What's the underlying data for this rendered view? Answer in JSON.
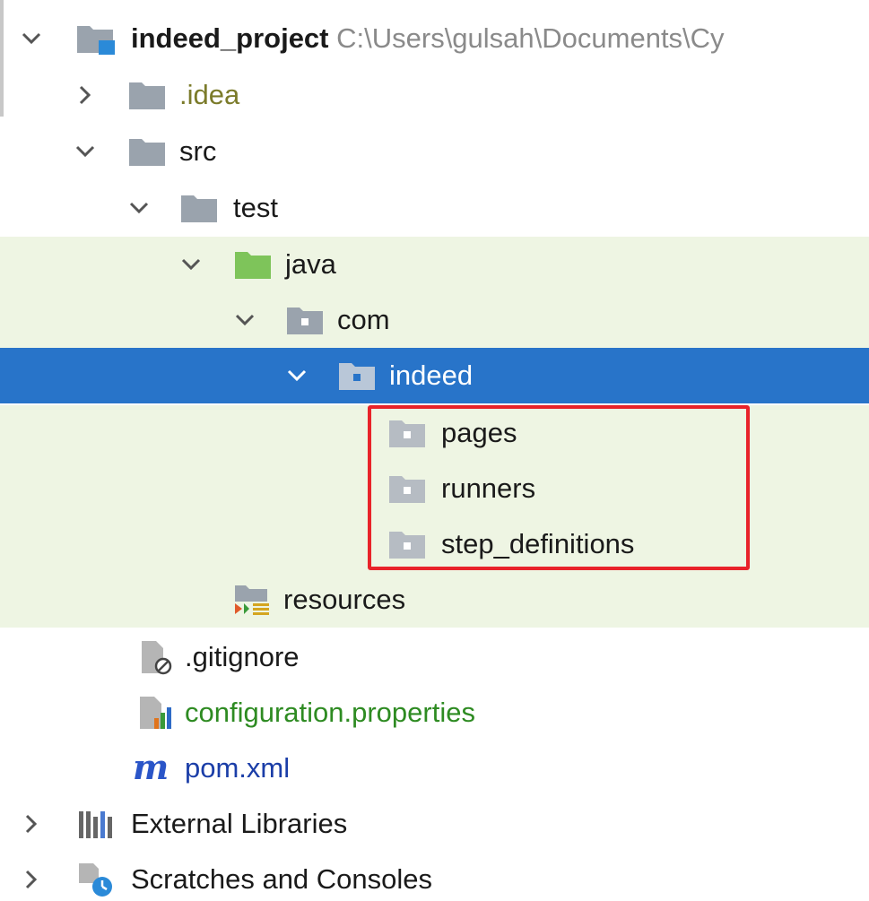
{
  "project": {
    "name": "indeed_project",
    "path": "C:\\Users\\gulsah\\Documents\\Cy"
  },
  "items": {
    "idea": ".idea",
    "src": "src",
    "test": "test",
    "java": "java",
    "com": "com",
    "indeed": "indeed",
    "pages": "pages",
    "runners": "runners",
    "step_definitions": "step_definitions",
    "resources": "resources",
    "gitignore": ".gitignore",
    "configuration": "configuration.properties",
    "pom": "pom.xml",
    "external_libraries": "External Libraries",
    "scratches": "Scratches and Consoles"
  },
  "colors": {
    "selection": "#2874c9",
    "source_root_tint": "#eef5e3",
    "highlight_box": "#e8232a",
    "folder_gray": "#9aa3ad",
    "source_folder_green": "#7ec45a"
  }
}
